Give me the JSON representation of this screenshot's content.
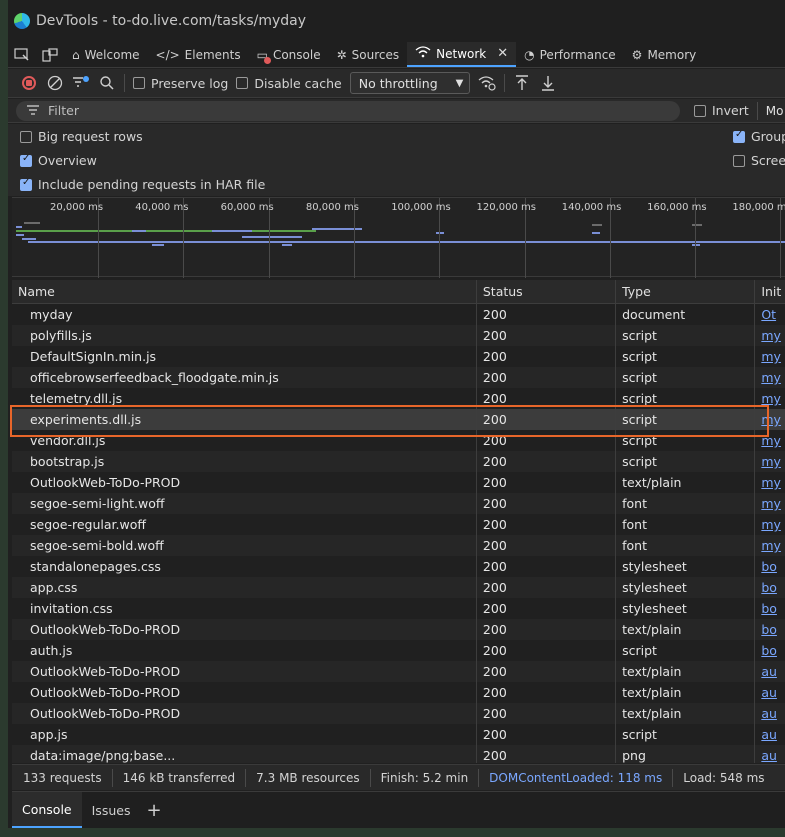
{
  "window": {
    "title": "DevTools - to-do.live.com/tasks/myday"
  },
  "tabs": [
    {
      "label": "Welcome",
      "icon": "home-icon"
    },
    {
      "label": "Elements",
      "icon": "code-icon"
    },
    {
      "label": "Console",
      "icon": "console-icon"
    },
    {
      "label": "Sources",
      "icon": "bug-icon"
    },
    {
      "label": "Network",
      "icon": "wifi-icon",
      "active": true
    },
    {
      "label": "Performance",
      "icon": "gauge-icon"
    },
    {
      "label": "Memory",
      "icon": "chip-icon"
    }
  ],
  "toolbar": {
    "preserve_log": "Preserve log",
    "disable_cache": "Disable cache",
    "throttling": "No throttling"
  },
  "filter": {
    "placeholder": "Filter",
    "invert": "Invert",
    "more": "Mo"
  },
  "settings": {
    "big_request_rows": "Big request rows",
    "overview": "Overview",
    "include_pending": "Include pending requests in HAR file",
    "group": "Group",
    "screen": "Screen"
  },
  "overview_ticks": [
    "20,000 ms",
    "40,000 ms",
    "60,000 ms",
    "80,000 ms",
    "100,000 ms",
    "120,000 ms",
    "140,000 ms",
    "160,000 ms",
    "180,000 ms"
  ],
  "table": {
    "headers": {
      "name": "Name",
      "status": "Status",
      "type": "Type",
      "initiator": "Init"
    },
    "rows": [
      {
        "name": "myday",
        "status": "200",
        "type": "document",
        "init": "Ot"
      },
      {
        "name": "polyfills.js",
        "status": "200",
        "type": "script",
        "init": "my"
      },
      {
        "name": "DefaultSignIn.min.js",
        "status": "200",
        "type": "script",
        "init": "my"
      },
      {
        "name": "officebrowserfeedback_floodgate.min.js",
        "status": "200",
        "type": "script",
        "init": "my"
      },
      {
        "name": "telemetry.dll.js",
        "status": "200",
        "type": "script",
        "init": "my"
      },
      {
        "name": "experiments.dll.js",
        "status": "200",
        "type": "script",
        "init": "my",
        "selected": true
      },
      {
        "name": "vendor.dll.js",
        "status": "200",
        "type": "script",
        "init": "my"
      },
      {
        "name": "bootstrap.js",
        "status": "200",
        "type": "script",
        "init": "my"
      },
      {
        "name": "OutlookWeb-ToDo-PROD",
        "status": "200",
        "type": "text/plain",
        "init": "my"
      },
      {
        "name": "segoe-semi-light.woff",
        "status": "200",
        "type": "font",
        "init": "my"
      },
      {
        "name": "segoe-regular.woff",
        "status": "200",
        "type": "font",
        "init": "my"
      },
      {
        "name": "segoe-semi-bold.woff",
        "status": "200",
        "type": "font",
        "init": "my"
      },
      {
        "name": "standalonepages.css",
        "status": "200",
        "type": "stylesheet",
        "init": "bo"
      },
      {
        "name": "app.css",
        "status": "200",
        "type": "stylesheet",
        "init": "bo"
      },
      {
        "name": "invitation.css",
        "status": "200",
        "type": "stylesheet",
        "init": "bo"
      },
      {
        "name": "OutlookWeb-ToDo-PROD",
        "status": "200",
        "type": "text/plain",
        "init": "bo"
      },
      {
        "name": "auth.js",
        "status": "200",
        "type": "script",
        "init": "bo"
      },
      {
        "name": "OutlookWeb-ToDo-PROD",
        "status": "200",
        "type": "text/plain",
        "init": "au"
      },
      {
        "name": "OutlookWeb-ToDo-PROD",
        "status": "200",
        "type": "text/plain",
        "init": "au"
      },
      {
        "name": "OutlookWeb-ToDo-PROD",
        "status": "200",
        "type": "text/plain",
        "init": "au"
      },
      {
        "name": "app.js",
        "status": "200",
        "type": "script",
        "init": "au"
      },
      {
        "name": "data:image/png;base...",
        "status": "200",
        "type": "png",
        "init": "au"
      }
    ]
  },
  "summary": {
    "requests": "133 requests",
    "transferred": "146 kB transferred",
    "resources": "7.3 MB resources",
    "finish": "Finish: 5.2 min",
    "dcl": "DOMContentLoaded: 118 ms",
    "load": "Load: 548 ms"
  },
  "drawer": {
    "console": "Console",
    "issues": "Issues",
    "add": "+"
  },
  "colors": {
    "accent": "#4da3ff",
    "highlight": "#e8662a",
    "link": "#7aa7ff"
  }
}
